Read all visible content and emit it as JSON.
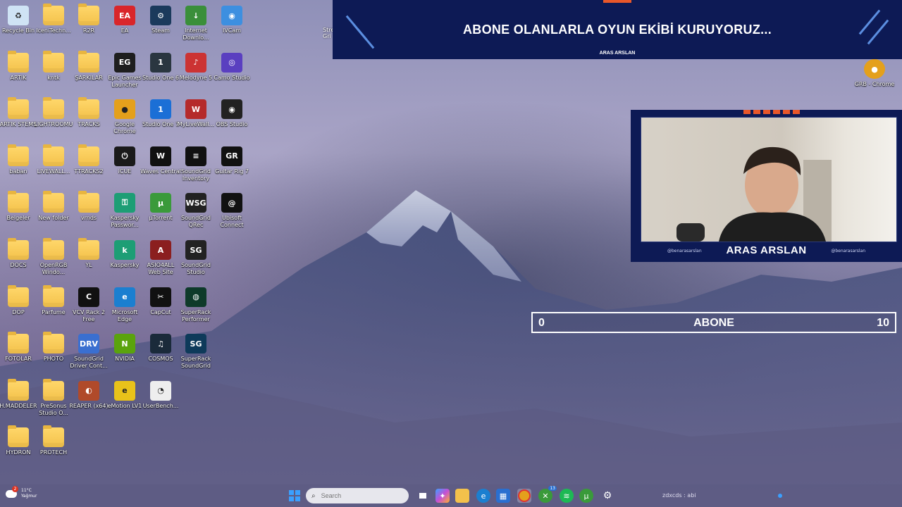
{
  "desktop": {
    "icons": [
      {
        "label": "Recycle Bin",
        "icon": "recycle-bin-icon",
        "type": "app",
        "color": "#cfe3f5",
        "glyph": "♻"
      },
      {
        "label": "IceniTechn...",
        "icon": "folder-icon",
        "type": "folder"
      },
      {
        "label": "R2R",
        "icon": "folder-icon",
        "type": "folder"
      },
      {
        "label": "EA",
        "icon": "ea-icon",
        "type": "app",
        "color": "#d9262a",
        "glyph": "EA"
      },
      {
        "label": "Steam",
        "icon": "steam-icon",
        "type": "app",
        "color": "#1b3a5c",
        "glyph": "⚙"
      },
      {
        "label": "Internet Downlo...",
        "icon": "idm-icon",
        "type": "app",
        "color": "#3a8f3a",
        "glyph": "↓"
      },
      {
        "label": "IVCam",
        "icon": "ivcam-icon",
        "type": "app",
        "color": "#3d8fe0",
        "glyph": "◉"
      },
      {
        "label": "ARTIK",
        "icon": "folder-icon",
        "type": "folder"
      },
      {
        "label": "kntk",
        "icon": "folder-icon",
        "type": "folder"
      },
      {
        "label": "ŞARKILAR",
        "icon": "folder-icon",
        "type": "folder"
      },
      {
        "label": "Epic Games Launcher",
        "icon": "epic-games-icon",
        "type": "app",
        "color": "#1e1e1e",
        "glyph": "EG"
      },
      {
        "label": "Studio One 6",
        "icon": "studio-one-icon",
        "type": "app",
        "color": "#2a3640",
        "glyph": "1"
      },
      {
        "label": "Melodyne 5",
        "icon": "melodyne-icon",
        "type": "app",
        "color": "#c33",
        "glyph": "♪"
      },
      {
        "label": "Camo Studio",
        "icon": "camo-icon",
        "type": "app",
        "color": "#5a3fc0",
        "glyph": "◎"
      },
      {
        "label": "ARTIK STEMS",
        "icon": "folder-icon",
        "type": "folder"
      },
      {
        "label": "LIGHTROOMU",
        "icon": "folder-icon",
        "type": "folder"
      },
      {
        "label": "TRACKS",
        "icon": "folder-icon",
        "type": "folder"
      },
      {
        "label": "Google Chrome",
        "icon": "chrome-icon",
        "type": "app",
        "color": "#e4a01c",
        "glyph": "●"
      },
      {
        "label": "Studio One 7",
        "icon": "studio-one-icon",
        "type": "app",
        "color": "#1b6fd6",
        "glyph": "1"
      },
      {
        "label": "MyLiveWall...",
        "icon": "wolf-icon",
        "type": "app",
        "color": "#b52a2a",
        "glyph": "W"
      },
      {
        "label": "OBS Studio",
        "icon": "obs-icon",
        "type": "app",
        "color": "#222",
        "glyph": "◉"
      },
      {
        "label": "baban",
        "icon": "folder-icon",
        "type": "folder"
      },
      {
        "label": "LIVEWALL...",
        "icon": "folder-icon",
        "type": "folder"
      },
      {
        "label": "TTRACKS2",
        "icon": "folder-icon",
        "type": "folder"
      },
      {
        "label": "iCUE",
        "icon": "icue-icon",
        "type": "app",
        "color": "#1a1a1a",
        "glyph": "⏻"
      },
      {
        "label": "Waves Central",
        "icon": "waves-icon",
        "type": "app",
        "color": "#111",
        "glyph": "W"
      },
      {
        "label": "SoundGrid Inventory",
        "icon": "soundgrid-icon",
        "type": "app",
        "color": "#111",
        "glyph": "≡"
      },
      {
        "label": "Guitar Rig 7",
        "icon": "guitar-rig-icon",
        "type": "app",
        "color": "#111",
        "glyph": "GR"
      },
      {
        "label": "Belgeler",
        "icon": "folder-icon",
        "type": "folder"
      },
      {
        "label": "New folder",
        "icon": "folder-icon",
        "type": "folder"
      },
      {
        "label": "vrnds",
        "icon": "folder-icon",
        "type": "folder"
      },
      {
        "label": "Kaspersky Passwor...",
        "icon": "kaspersky-icon",
        "type": "app",
        "color": "#1d9e75",
        "glyph": "⚿"
      },
      {
        "label": "µTorrent",
        "icon": "utorrent-icon",
        "type": "app",
        "color": "#3a9a3a",
        "glyph": "µ"
      },
      {
        "label": "SoundGrid QRec",
        "icon": "soundgrid-icon",
        "type": "app",
        "color": "#222",
        "glyph": "WSG"
      },
      {
        "label": "Ubisoft Connect",
        "icon": "ubisoft-icon",
        "type": "app",
        "color": "#111",
        "glyph": "@"
      },
      {
        "label": "DOCS",
        "icon": "folder-icon",
        "type": "folder"
      },
      {
        "label": "OpenRGB Windo...",
        "icon": "folder-icon",
        "type": "folder"
      },
      {
        "label": "YL",
        "icon": "folder-icon",
        "type": "folder"
      },
      {
        "label": "Kaspersky",
        "icon": "kaspersky-icon",
        "type": "app",
        "color": "#1d9e75",
        "glyph": "k"
      },
      {
        "label": "ASIO4ALL Web Site",
        "icon": "asio-icon",
        "type": "app",
        "color": "#8b1f1f",
        "glyph": "A"
      },
      {
        "label": "SoundGrid Studio",
        "icon": "soundgrid-icon",
        "type": "app",
        "color": "#222",
        "glyph": "SG"
      },
      {
        "label": "DOP",
        "icon": "folder-icon",
        "type": "folder"
      },
      {
        "label": "Parfume",
        "icon": "folder-icon",
        "type": "folder"
      },
      {
        "label": "VCV Rack 2 Free",
        "icon": "vcv-icon",
        "type": "app",
        "color": "#111",
        "glyph": "C"
      },
      {
        "label": "Microsoft Edge",
        "icon": "edge-icon",
        "type": "app",
        "color": "#1b7fd0",
        "glyph": "e"
      },
      {
        "label": "CapCut",
        "icon": "capcut-icon",
        "type": "app",
        "color": "#111",
        "glyph": "✂"
      },
      {
        "label": "SuperRack Performer",
        "icon": "superrack-icon",
        "type": "app",
        "color": "#0e3a2a",
        "glyph": "◍"
      },
      {
        "label": "FOTOLAR",
        "icon": "folder-icon",
        "type": "folder"
      },
      {
        "label": "PHOTO",
        "icon": "folder-icon",
        "type": "folder"
      },
      {
        "label": "SoundGrid Driver Cont...",
        "icon": "soundgrid-icon",
        "type": "app",
        "color": "#3a6fd0",
        "glyph": "DRV"
      },
      {
        "label": "NVIDIA",
        "icon": "nvidia-icon",
        "type": "app",
        "color": "#5aa30d",
        "glyph": "N"
      },
      {
        "label": "COSMOS",
        "icon": "cosmos-icon",
        "type": "app",
        "color": "#1a2a3a",
        "glyph": "♫"
      },
      {
        "label": "SuperRack SoundGrid",
        "icon": "superrack-icon",
        "type": "app",
        "color": "#0e3a5a",
        "glyph": "SG"
      },
      {
        "label": "H.MADDELER",
        "icon": "folder-icon",
        "type": "folder"
      },
      {
        "label": "PreSonus Studio O...",
        "icon": "folder-icon",
        "type": "folder"
      },
      {
        "label": "REAPER (x64)",
        "icon": "reaper-icon",
        "type": "app",
        "color": "#b04a2a",
        "glyph": "◐"
      },
      {
        "label": "eMotion LV1",
        "icon": "emotion-icon",
        "type": "app",
        "color": "#e8c21a",
        "glyph": "e"
      },
      {
        "label": "UserBench...",
        "icon": "userbench-icon",
        "type": "app",
        "color": "#eee",
        "glyph": "◔"
      },
      {
        "label": "HYDRON",
        "icon": "folder-icon",
        "type": "folder"
      },
      {
        "label": "PROTECH",
        "icon": "folder-icon",
        "type": "folder"
      }
    ],
    "partial_right": [
      {
        "label": "GRB - Chrome",
        "icon": "chrome-icon"
      }
    ],
    "partial_left_label": "Stre Gri"
  },
  "stream_banner": {
    "title": "ABONE OLANLARLA OYUN EKİBİ KURUYORUZ...",
    "name": "ARAS ARSLAN"
  },
  "webcam": {
    "name": "ARAS ARSLAN",
    "handle_left": "@benarasarslan",
    "handle_right": "@benarasarslan"
  },
  "goal": {
    "label": "ABONE",
    "current": "0",
    "target": "10",
    "progress": 0
  },
  "taskbar": {
    "weather_temp": "11°C",
    "weather_desc": "Yağmur",
    "search_placeholder": "Search",
    "notification_badge": "2",
    "xbox_badge": "13",
    "tray_text": "zdxcds : abi"
  },
  "colors": {
    "banner_bg": "#0d1a55",
    "accent_orange": "#e8572a",
    "folder": "#f3c14b"
  }
}
